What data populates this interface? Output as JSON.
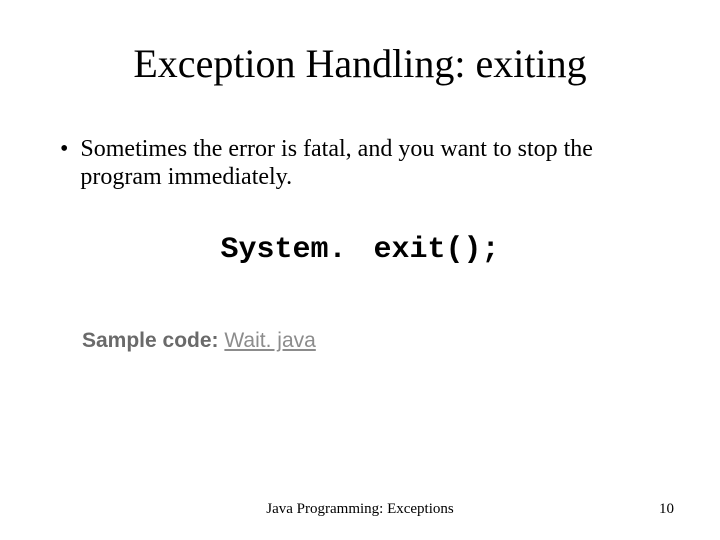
{
  "title": "Exception Handling: exiting",
  "bullet": {
    "marker": "•",
    "text": "Sometimes the error is fatal, and you want to stop the program immediately."
  },
  "code": "System. exit();",
  "sample": {
    "label": "Sample code: ",
    "link": "Wait. java"
  },
  "footer": "Java Programming: Exceptions",
  "page_number": "10"
}
